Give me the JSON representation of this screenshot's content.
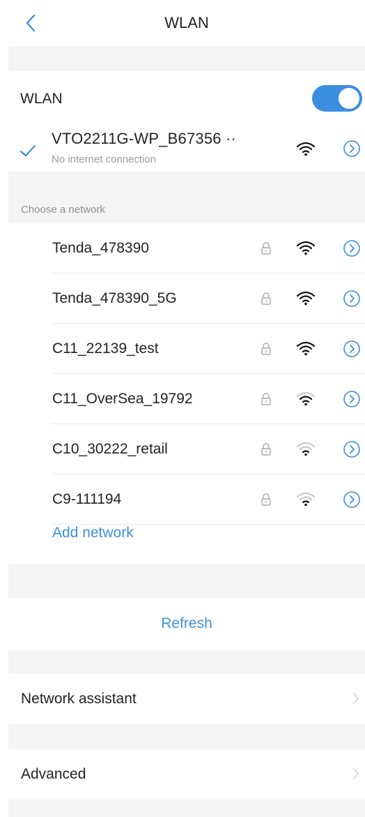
{
  "header": {
    "title": "WLAN",
    "back_icon": "chevron-left-icon"
  },
  "wlan": {
    "label": "WLAN",
    "enabled": true,
    "connected": {
      "name": "VTO2211G-WP_B67356 ··",
      "status": "No internet connection",
      "signal": "full"
    }
  },
  "section": {
    "choose_label": "Choose a network"
  },
  "networks": [
    {
      "name": "Tenda_478390",
      "locked": true,
      "signal": "strong"
    },
    {
      "name": "Tenda_478390_5G",
      "locked": true,
      "signal": "strong"
    },
    {
      "name": "C11_22139_test",
      "locked": true,
      "signal": "strong"
    },
    {
      "name": "C11_OverSea_19792",
      "locked": true,
      "signal": "medium"
    },
    {
      "name": "C10_30222_retail",
      "locked": true,
      "signal": "weak"
    },
    {
      "name": "C9-111194",
      "locked": true,
      "signal": "weak"
    }
  ],
  "actions": {
    "add_network": "Add network",
    "refresh": "Refresh",
    "network_assistant": "Network assistant",
    "advanced": "Advanced"
  },
  "colors": {
    "accent": "#3b8ee0",
    "link": "#3d8fe0",
    "background": "#f4f4f4"
  }
}
